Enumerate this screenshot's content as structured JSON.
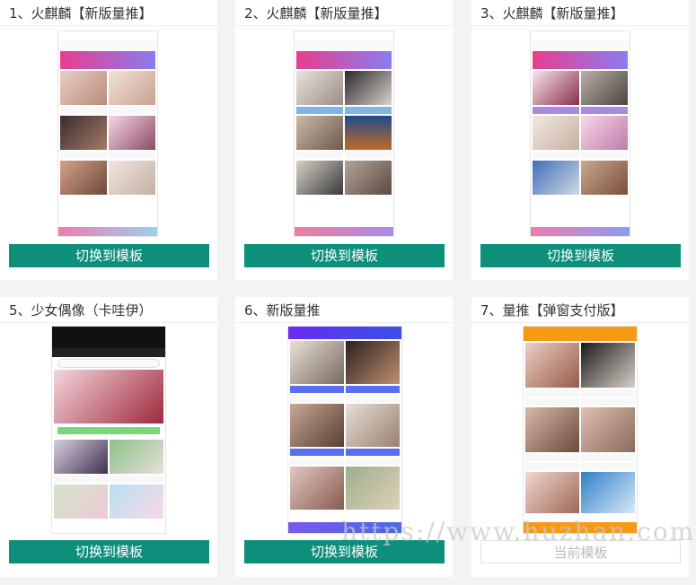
{
  "cards": [
    {
      "title": "1、火麒麟【新版量推】",
      "button": "切换到模板"
    },
    {
      "title": "2、火麒麟【新版量推】",
      "button": "切换到模板"
    },
    {
      "title": "3、火麒麟【新版量推】",
      "button": "切换到模板"
    },
    {
      "title": "5、少女偶像（卡哇伊）",
      "button": "切换到模板"
    },
    {
      "title": "6、新版量推",
      "button": "切换到模板"
    },
    {
      "title": "7、量推【弹窗支付版】",
      "button": "当前模板"
    }
  ],
  "watermark": "https://www.huzhan.com",
  "colors": {
    "button": "#0d8f7b",
    "banner_gradient": [
      "#e83e8c",
      "#8a7cf0"
    ]
  }
}
